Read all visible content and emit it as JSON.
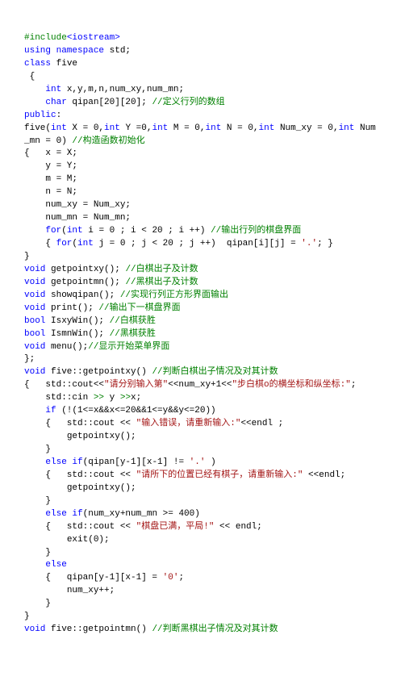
{
  "l": [
    [
      "g",
      "#include"
    ],
    [
      "b",
      "<iostream>"
    ],
    [
      "nl"
    ],
    [
      "b",
      "using namespace"
    ],
    [
      "k",
      " std;"
    ],
    [
      "nl"
    ],
    [
      "b",
      "class"
    ],
    [
      "k",
      " five"
    ],
    [
      "nl"
    ],
    [
      "k",
      " {"
    ],
    [
      "nl"
    ],
    [
      "k",
      "    "
    ],
    [
      "b",
      "int"
    ],
    [
      "k",
      " x,y,m,n,num_xy,num_mn;"
    ],
    [
      "nl"
    ],
    [
      "k",
      "    "
    ],
    [
      "b",
      "char"
    ],
    [
      "k",
      " qipan[20][20]; "
    ],
    [
      "g",
      "//定义行列的数组"
    ],
    [
      "nl"
    ],
    [
      "b",
      "public"
    ],
    [
      "k",
      ":"
    ],
    [
      "nl"
    ],
    [
      "k",
      "five("
    ],
    [
      "b",
      "int"
    ],
    [
      "k",
      " X = 0,"
    ],
    [
      "b",
      "int"
    ],
    [
      "k",
      " Y =0,"
    ],
    [
      "b",
      "int"
    ],
    [
      "k",
      " M = 0,"
    ],
    [
      "b",
      "int"
    ],
    [
      "k",
      " N = 0,"
    ],
    [
      "b",
      "int"
    ],
    [
      "k",
      " Num_xy = 0,"
    ],
    [
      "b",
      "int"
    ],
    [
      "k",
      " Num_mn = 0) "
    ],
    [
      "g",
      "//构造函数初始化"
    ],
    [
      "nl"
    ],
    [
      "k",
      "{   x = X;"
    ],
    [
      "nl"
    ],
    [
      "k",
      "    y = Y;"
    ],
    [
      "nl"
    ],
    [
      "k",
      "    m = M;"
    ],
    [
      "nl"
    ],
    [
      "k",
      "    n = N;"
    ],
    [
      "nl"
    ],
    [
      "k",
      "    num_xy = Num_xy;"
    ],
    [
      "nl"
    ],
    [
      "k",
      "    num_mn = Num_mn;"
    ],
    [
      "nl"
    ],
    [
      "k",
      "    "
    ],
    [
      "b",
      "for"
    ],
    [
      "k",
      "("
    ],
    [
      "b",
      "int"
    ],
    [
      "k",
      " i = 0 ; i < 20 ; i ++) "
    ],
    [
      "g",
      "//输出行列的棋盘界面"
    ],
    [
      "nl"
    ],
    [
      "k",
      "    { "
    ],
    [
      "b",
      "for"
    ],
    [
      "k",
      "("
    ],
    [
      "b",
      "int"
    ],
    [
      "k",
      " j = 0 ; j < 20 ; j ++)  qipan[i][j] = "
    ],
    [
      "r",
      "'.'"
    ],
    [
      "k",
      "; }"
    ],
    [
      "nl"
    ],
    [
      "k",
      "}"
    ],
    [
      "nl"
    ],
    [
      "b",
      "void"
    ],
    [
      "k",
      " getpointxy(); "
    ],
    [
      "g",
      "//白棋出子及计数"
    ],
    [
      "nl"
    ],
    [
      "b",
      "void"
    ],
    [
      "k",
      " getpointmn(); "
    ],
    [
      "g",
      "//黑棋出子及计数"
    ],
    [
      "nl"
    ],
    [
      "b",
      "void"
    ],
    [
      "k",
      " showqipan(); "
    ],
    [
      "g",
      "//实现行列正方形界面输出"
    ],
    [
      "nl"
    ],
    [
      "b",
      "void"
    ],
    [
      "k",
      " print(); "
    ],
    [
      "g",
      "//输出下一棋盘界面"
    ],
    [
      "nl"
    ],
    [
      "b",
      "bool"
    ],
    [
      "k",
      " IsxyWin(); "
    ],
    [
      "g",
      "//白棋获胜"
    ],
    [
      "nl"
    ],
    [
      "b",
      "bool"
    ],
    [
      "k",
      " IsmnWin(); "
    ],
    [
      "g",
      "//黑棋获胜"
    ],
    [
      "nl"
    ],
    [
      "b",
      "void"
    ],
    [
      "k",
      " menu();"
    ],
    [
      "g",
      "//显示开始菜单界面"
    ],
    [
      "nl"
    ],
    [
      "k",
      "};"
    ],
    [
      "nl"
    ],
    [
      "b",
      "void"
    ],
    [
      "k",
      " five::getpointxy() "
    ],
    [
      "g",
      "//判断白棋出子情况及对其计数"
    ],
    [
      "nl"
    ],
    [
      "k",
      "{   std::cout<<"
    ],
    [
      "r",
      "\"请分别输入第\""
    ],
    [
      "k",
      "<<num_xy+1<<"
    ],
    [
      "r",
      "\"步白棋o的横坐标和纵坐标:\""
    ],
    [
      "k",
      ";"
    ],
    [
      "nl"
    ],
    [
      "k",
      "    std::cin"
    ],
    [
      "g",
      " >>"
    ],
    [
      "k",
      " y "
    ],
    [
      "g",
      ">>"
    ],
    [
      "k",
      "x;"
    ],
    [
      "nl"
    ],
    [
      "k",
      "    "
    ],
    [
      "b",
      "if"
    ],
    [
      "k",
      " (!(1<=x&&x<=20&&1<=y&&y<=20))"
    ],
    [
      "nl"
    ],
    [
      "k",
      "    {   std::cout << "
    ],
    [
      "r",
      "\"输入错误，请重新输入:\""
    ],
    [
      "k",
      "<<endl ;"
    ],
    [
      "nl"
    ],
    [
      "k",
      "        getpointxy();"
    ],
    [
      "nl"
    ],
    [
      "k",
      "    }"
    ],
    [
      "nl"
    ],
    [
      "k",
      "    "
    ],
    [
      "b",
      "else if"
    ],
    [
      "k",
      "(qipan[y-1][x-1] != "
    ],
    [
      "r",
      "'.'"
    ],
    [
      "k",
      " )"
    ],
    [
      "nl"
    ],
    [
      "k",
      "    {   std::cout << "
    ],
    [
      "r",
      "\"请所下的位置已经有棋子，请重新输入:\""
    ],
    [
      "k",
      " <<endl;"
    ],
    [
      "nl"
    ],
    [
      "k",
      "        getpointxy();"
    ],
    [
      "nl"
    ],
    [
      "k",
      "    }"
    ],
    [
      "nl"
    ],
    [
      "k",
      "    "
    ],
    [
      "b",
      "else if"
    ],
    [
      "k",
      "(num_xy+num_mn >= 400)"
    ],
    [
      "nl"
    ],
    [
      "k",
      "    {   std::cout << "
    ],
    [
      "r",
      "\"棋盘已满，平局!\""
    ],
    [
      "k",
      " << endl;"
    ],
    [
      "nl"
    ],
    [
      "k",
      "        exit(0);"
    ],
    [
      "nl"
    ],
    [
      "k",
      "    }"
    ],
    [
      "nl"
    ],
    [
      "k",
      "    "
    ],
    [
      "b",
      "else"
    ],
    [
      "nl"
    ],
    [
      "k",
      "    {   qipan[y-1][x-1] = "
    ],
    [
      "r",
      "'0'"
    ],
    [
      "k",
      ";"
    ],
    [
      "nl"
    ],
    [
      "k",
      "        num_xy++;"
    ],
    [
      "nl"
    ],
    [
      "k",
      "    }"
    ],
    [
      "nl"
    ],
    [
      "k",
      "}"
    ],
    [
      "nl"
    ],
    [
      "b",
      "void"
    ],
    [
      "k",
      " five::getpointmn() "
    ],
    [
      "g",
      "//判断黑棋出子情况及对其计数"
    ],
    [
      "nl"
    ]
  ]
}
